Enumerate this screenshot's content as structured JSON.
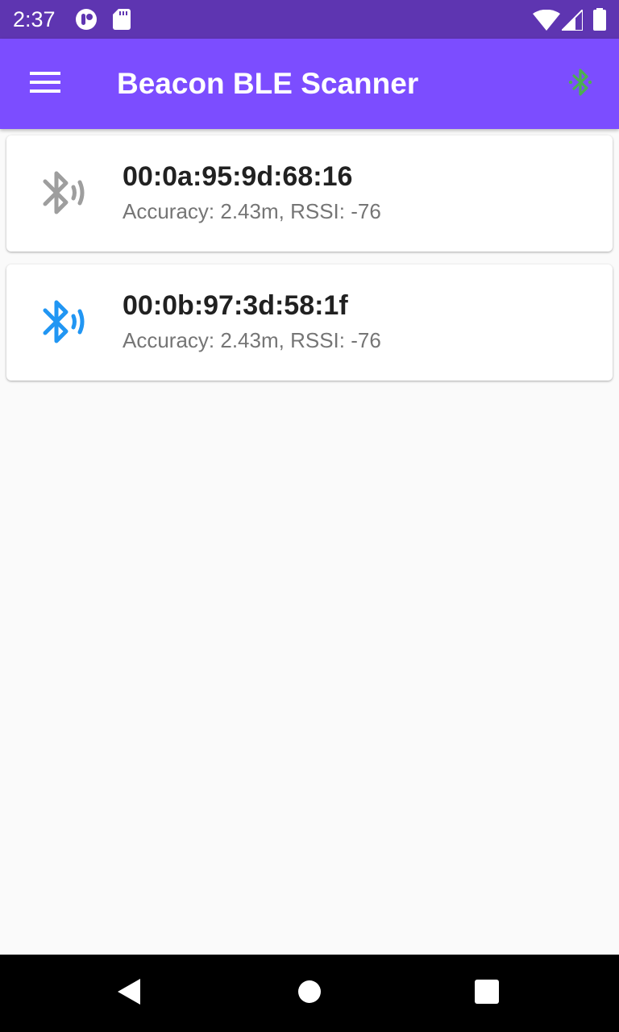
{
  "status_bar": {
    "time": "2:37",
    "icons": [
      "notification-app-icon",
      "sd-card-icon",
      "wifi-icon",
      "cell-signal-icon",
      "battery-icon"
    ]
  },
  "app_bar": {
    "title": "Beacon BLE Scanner",
    "menu_icon": "menu-icon",
    "action_icon": "bluetooth-searching-icon",
    "action_icon_color": "#4caf50"
  },
  "colors": {
    "status_bar": "#5e35b1",
    "app_bar": "#7c4dff",
    "inactive_beacon": "#9e9e9e",
    "active_beacon": "#2196f3"
  },
  "beacons": [
    {
      "address": "00:0a:95:9d:68:16",
      "details": "Accuracy: 2.43m, RSSI: -76",
      "icon": "bluetooth-audio-icon",
      "icon_color": "#9e9e9e"
    },
    {
      "address": "00:0b:97:3d:58:1f",
      "details": "Accuracy: 2.43m, RSSI: -76",
      "icon": "bluetooth-audio-icon",
      "icon_color": "#2196f3"
    }
  ],
  "nav_bar": {
    "buttons": [
      "back-icon",
      "home-icon",
      "recents-icon"
    ]
  }
}
